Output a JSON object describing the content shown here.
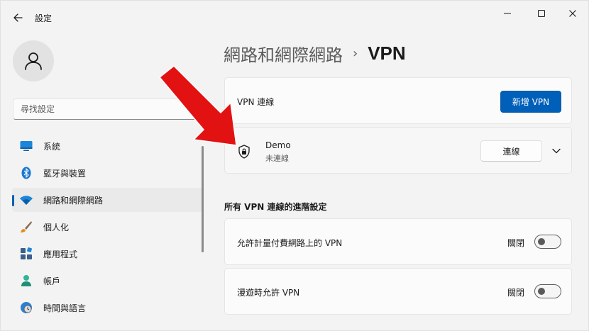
{
  "window": {
    "title": "設定"
  },
  "sidebar": {
    "search_placeholder": "尋找設定",
    "items": [
      {
        "label": "系統",
        "icon": "monitor-icon"
      },
      {
        "label": "藍牙與裝置",
        "icon": "bluetooth-icon"
      },
      {
        "label": "網路和網際網路",
        "icon": "wifi-icon",
        "active": true
      },
      {
        "label": "個人化",
        "icon": "brush-icon"
      },
      {
        "label": "應用程式",
        "icon": "apps-icon"
      },
      {
        "label": "帳戶",
        "icon": "person-icon"
      },
      {
        "label": "時間與語言",
        "icon": "clock-globe-icon"
      }
    ]
  },
  "breadcrumb": {
    "parent": "網路和網際網路",
    "separator": "›",
    "current": "VPN"
  },
  "vpn_connections": {
    "label": "VPN 連線",
    "add_button": "新增 VPN"
  },
  "demo_connection": {
    "name": "Demo",
    "status": "未連線",
    "connect_button": "連線"
  },
  "advanced": {
    "title": "所有 VPN 連線的進階設定",
    "settings": [
      {
        "label": "允許計量付費網路上的 VPN",
        "state": "關閉"
      },
      {
        "label": "漫遊時允許 VPN",
        "state": "關閉"
      }
    ]
  },
  "colors": {
    "accent": "#005fb8",
    "arrow": "#e31212",
    "background": "#f3f3f3",
    "card": "#fbfbfb"
  }
}
